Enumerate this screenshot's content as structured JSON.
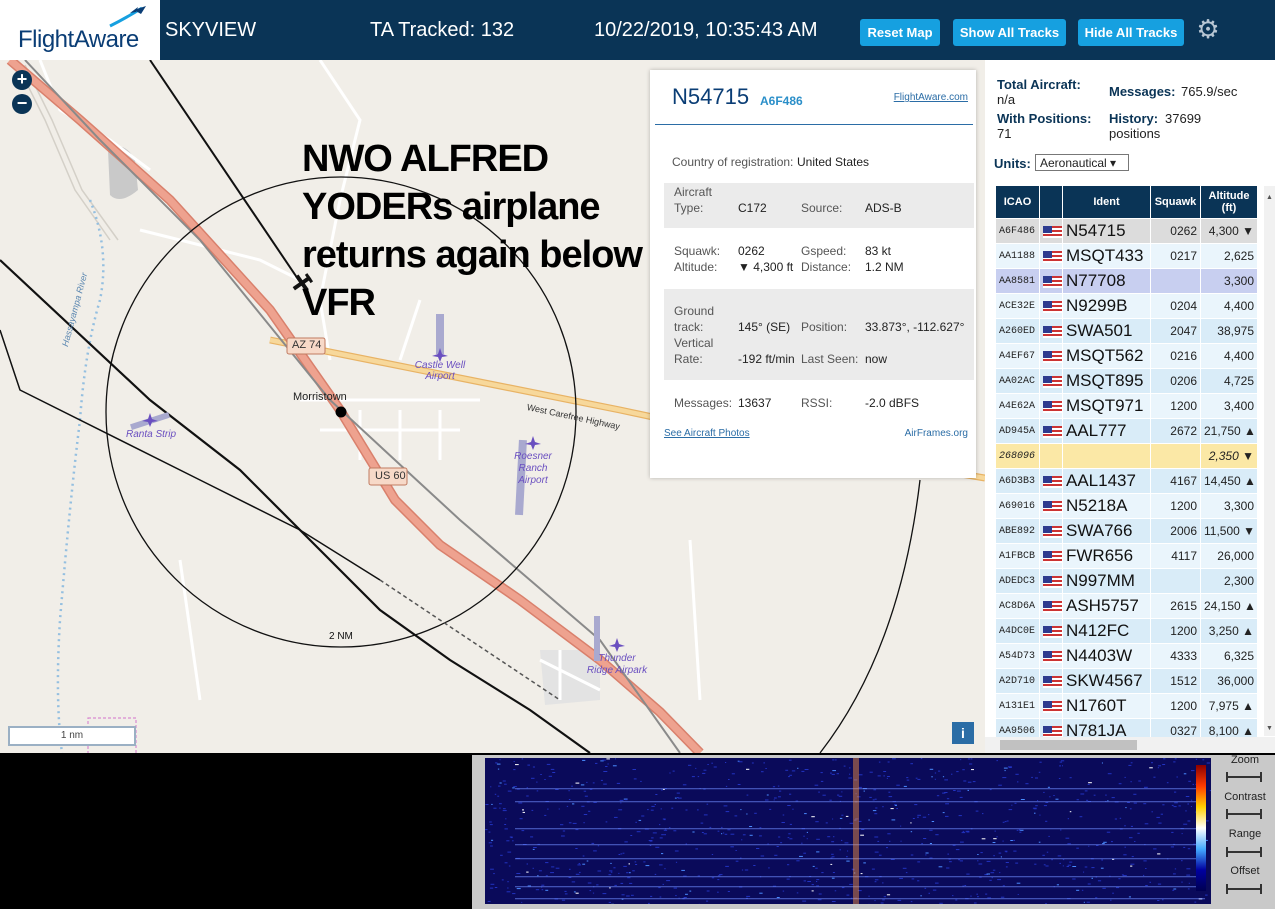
{
  "header": {
    "logo_text": "FlightAware",
    "title": "SKYVIEW",
    "tracked": "TA Tracked: 132",
    "datetime": "10/22/2019, 10:35:43 AM",
    "buttons": {
      "reset": "Reset Map",
      "show": "Show All Tracks",
      "hide": "Hide All Tracks"
    },
    "settings_icon": "gear-icon"
  },
  "map": {
    "annotation_lines": [
      "NWO ALFRED",
      "YODERs airplane",
      "returns again below",
      "VFR"
    ],
    "labels": {
      "az74": "AZ 74",
      "us60": "US 60",
      "morristown": "Morristown",
      "castle_well": [
        "Castle Well",
        "Airport"
      ],
      "ranta": "Ranta Strip",
      "roesner": [
        "Roesner",
        "Ranch",
        "Airport"
      ],
      "thunder": [
        "Thunder",
        "Ridge Airpark"
      ],
      "highway": "West Carefree Highway",
      "river": "Hassayampa River",
      "range_ring": "2 NM"
    },
    "scale": "1 nm",
    "info_button": "i",
    "zoom_in": "+",
    "zoom_out": "−"
  },
  "popup": {
    "callsign": "N54715",
    "hex": "A6F486",
    "fa_link": "FlightAware.com",
    "country_label": "Country of registration:",
    "country": "United States",
    "aircraft_type_label_1": "Aircraft",
    "aircraft_type_label_2": "Type:",
    "aircraft_type": "C172",
    "source_label": "Source:",
    "source": "ADS-B",
    "squawk_label": "Squawk:",
    "squawk": "0262",
    "gspeed_label": "Gspeed:",
    "gspeed": "83 kt",
    "altitude_label": "Altitude:",
    "altitude": "▼ 4,300 ft",
    "distance_label": "Distance:",
    "distance": "1.2 NM",
    "ground_label_1": "Ground",
    "ground_label_2": "track:",
    "track": "145° (SE)",
    "position_label": "Position:",
    "position": "33.873°, -112.627°",
    "vrate_label_1": "Vertical",
    "vrate_label_2": "Rate:",
    "vrate": "-192 ft/min",
    "lastseen_label": "Last Seen:",
    "lastseen": "now",
    "messages_label": "Messages:",
    "messages": "13637",
    "rssi_label": "RSSI:",
    "rssi": "-2.0 dBFS",
    "photos_link": "See Aircraft Photos",
    "airframes_link": "AirFrames.org"
  },
  "sidebar": {
    "total_label": "Total Aircraft:",
    "total": "n/a",
    "messages_label": "Messages:",
    "messages": "765.9/sec",
    "withpos_label": "With Positions:",
    "withpos": "71",
    "history_label": "History:",
    "history": "37699",
    "history_unit": "positions",
    "units_label": "Units:",
    "units_value": "Aeronautical ▾",
    "columns": [
      "ICAO",
      "",
      "Ident",
      "Squawk",
      "Altitude (ft)"
    ],
    "rows": [
      {
        "icao": "A6F486",
        "flag": true,
        "ident": "N54715",
        "squawk": "0262",
        "alt": "4,300 ▼",
        "sel": "selected"
      },
      {
        "icao": "AA1188",
        "flag": true,
        "ident": "MSQT433",
        "squawk": "0217",
        "alt": "2,625",
        "sel": ""
      },
      {
        "icao": "AA8581",
        "flag": true,
        "ident": "N77708",
        "squawk": "",
        "alt": "3,300",
        "sel": "hover"
      },
      {
        "icao": "ACE32E",
        "flag": true,
        "ident": "N9299B",
        "squawk": "0204",
        "alt": "4,400",
        "sel": ""
      },
      {
        "icao": "A260ED",
        "flag": true,
        "ident": "SWA501",
        "squawk": "2047",
        "alt": "38,975",
        "sel": ""
      },
      {
        "icao": "A4EF67",
        "flag": true,
        "ident": "MSQT562",
        "squawk": "0216",
        "alt": "4,400",
        "sel": ""
      },
      {
        "icao": "AA02AC",
        "flag": true,
        "ident": "MSQT895",
        "squawk": "0206",
        "alt": "4,725",
        "sel": ""
      },
      {
        "icao": "A4E62A",
        "flag": true,
        "ident": "MSQT971",
        "squawk": "1200",
        "alt": "3,400",
        "sel": ""
      },
      {
        "icao": "AD945A",
        "flag": true,
        "ident": "AAL777",
        "squawk": "2672",
        "alt": "21,750 ▲",
        "sel": ""
      },
      {
        "icao": "268096",
        "flag": false,
        "ident": "",
        "squawk": "",
        "alt": "2,350 ▼",
        "sel": "mlat"
      },
      {
        "icao": "A6D3B3",
        "flag": true,
        "ident": "AAL1437",
        "squawk": "4167",
        "alt": "14,450 ▲",
        "sel": ""
      },
      {
        "icao": "A69016",
        "flag": true,
        "ident": "N5218A",
        "squawk": "1200",
        "alt": "3,300",
        "sel": ""
      },
      {
        "icao": "ABE892",
        "flag": true,
        "ident": "SWA766",
        "squawk": "2006",
        "alt": "11,500 ▼",
        "sel": ""
      },
      {
        "icao": "A1FBCB",
        "flag": true,
        "ident": "FWR656",
        "squawk": "4117",
        "alt": "26,000",
        "sel": ""
      },
      {
        "icao": "ADEDC3",
        "flag": true,
        "ident": "N997MM",
        "squawk": "",
        "alt": "2,300",
        "sel": ""
      },
      {
        "icao": "AC8D6A",
        "flag": true,
        "ident": "ASH5757",
        "squawk": "2615",
        "alt": "24,150 ▲",
        "sel": ""
      },
      {
        "icao": "A4DC0E",
        "flag": true,
        "ident": "N412FC",
        "squawk": "1200",
        "alt": "3,250 ▲",
        "sel": ""
      },
      {
        "icao": "A54D73",
        "flag": true,
        "ident": "N4403W",
        "squawk": "4333",
        "alt": "6,325",
        "sel": ""
      },
      {
        "icao": "A2D710",
        "flag": true,
        "ident": "SKW4567",
        "squawk": "1512",
        "alt": "36,000",
        "sel": ""
      },
      {
        "icao": "A131E1",
        "flag": true,
        "ident": "N1760T",
        "squawk": "1200",
        "alt": "7,975 ▲",
        "sel": ""
      },
      {
        "icao": "AA9506",
        "flag": true,
        "ident": "N781JA",
        "squawk": "0327",
        "alt": "8,100 ▲",
        "sel": ""
      }
    ]
  },
  "waterfall": {
    "controls": [
      "Zoom",
      "Contrast",
      "Range",
      "Offset"
    ]
  }
}
